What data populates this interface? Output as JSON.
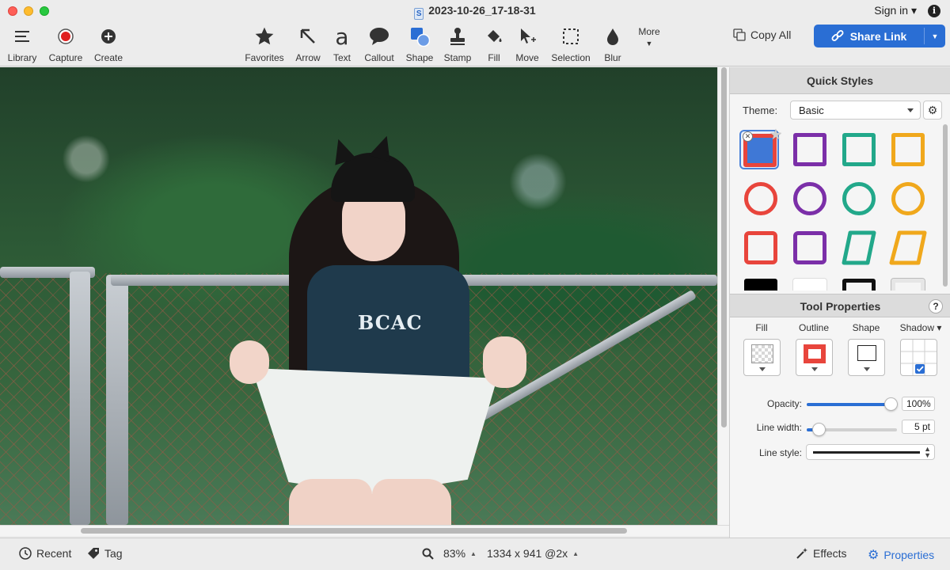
{
  "window": {
    "title": "2023-10-26_17-18-31",
    "signin": "Sign in ▾"
  },
  "toolbar": {
    "left": [
      {
        "icon": "hamburger-icon",
        "label": "Library"
      },
      {
        "icon": "record-icon",
        "label": "Capture"
      },
      {
        "icon": "plus-circle-icon",
        "label": "Create"
      }
    ],
    "tools": [
      {
        "icon": "star-icon",
        "label": "Favorites"
      },
      {
        "icon": "arrow-icon",
        "label": "Arrow"
      },
      {
        "icon": "text-icon",
        "glyph": "a",
        "label": "Text"
      },
      {
        "icon": "callout-icon",
        "label": "Callout"
      },
      {
        "icon": "shape-icon",
        "label": "Shape"
      },
      {
        "icon": "stamp-icon",
        "label": "Stamp"
      },
      {
        "icon": "fill-icon",
        "label": "Fill"
      },
      {
        "icon": "move-icon",
        "label": "Move"
      },
      {
        "icon": "selection-icon",
        "label": "Selection"
      },
      {
        "icon": "blur-icon",
        "label": "Blur"
      }
    ],
    "more_label": "More",
    "copy_all": "Copy All",
    "share_link": "Share Link",
    "accent": "#2a6ed4"
  },
  "image": {
    "shirt_text": "BCAC"
  },
  "quick_styles": {
    "title": "Quick Styles",
    "theme_label": "Theme:",
    "theme_value": "Basic",
    "colors": {
      "red": "#e8453c",
      "purple": "#7b2fa8",
      "teal": "#22a88a",
      "orange": "#f0a81c",
      "blue": "#3f78d6"
    }
  },
  "tool_properties": {
    "title": "Tool Properties",
    "help": "?",
    "columns": [
      "Fill",
      "Outline",
      "Shape",
      "Shadow ▾"
    ],
    "opacity_label": "Opacity:",
    "opacity_value": "100%",
    "opacity_level": 1.0,
    "line_width_label": "Line width:",
    "line_width_value": "5 pt",
    "line_width_level": 0.05,
    "line_style_label": "Line style:"
  },
  "bottom": {
    "recent": "Recent",
    "tag": "Tag",
    "zoom": "83%",
    "dimensions": "1334 x 941 @2x",
    "effects": "Effects",
    "properties": "Properties"
  }
}
